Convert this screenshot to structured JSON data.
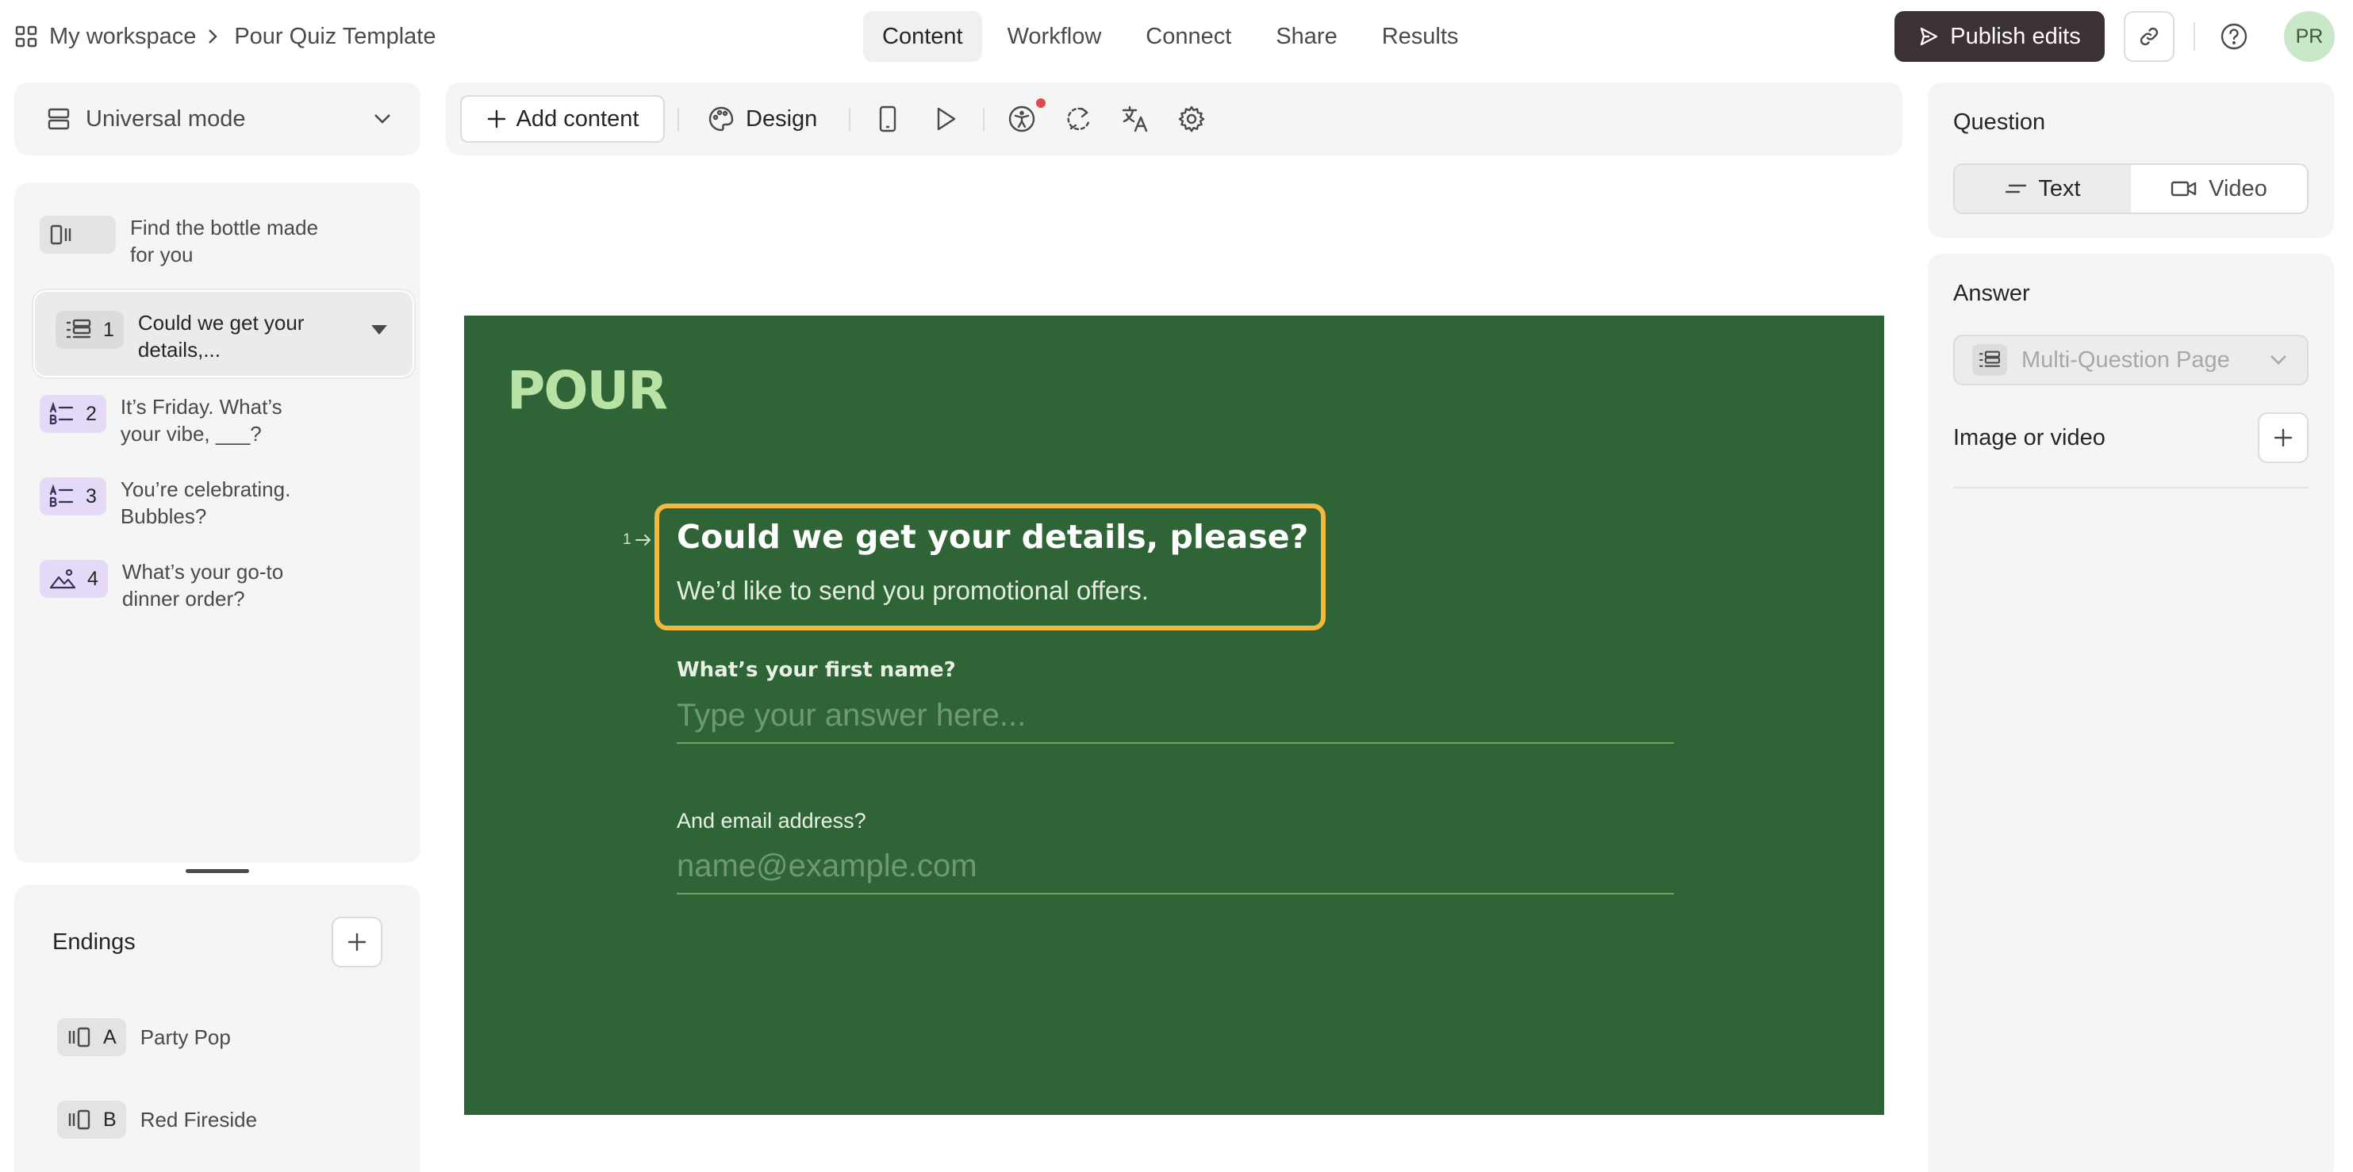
{
  "header": {
    "workspace": "My workspace",
    "separator": ">",
    "form_name": "Pour Quiz Template",
    "tabs": [
      {
        "label": "Content"
      },
      {
        "label": "Workflow"
      },
      {
        "label": "Connect"
      },
      {
        "label": "Share"
      },
      {
        "label": "Results"
      }
    ],
    "active_tab": "Content",
    "publish_label": "Publish edits",
    "avatar_initials": "PR"
  },
  "sidebar": {
    "mode_label": "Universal mode",
    "questions": [
      {
        "number": "",
        "text": "Find the bottle made for you",
        "type_icon": "welcome-screen-icon"
      },
      {
        "number": "1",
        "text": "Could we get your details,...",
        "type_icon": "multi-question-icon"
      },
      {
        "number": "2",
        "text": "It’s Friday. What’s your vibe, ___?",
        "type_icon": "multiple-choice-icon"
      },
      {
        "number": "3",
        "text": "You’re celebrating. Bubbles?",
        "type_icon": "multiple-choice-icon"
      },
      {
        "number": "4",
        "text": "What’s your go-to dinner order?",
        "type_icon": "picture-choice-icon"
      }
    ],
    "endings_title": "Endings",
    "endings": [
      {
        "letter": "A",
        "label": "Party Pop"
      },
      {
        "letter": "B",
        "label": "Red Fireside"
      }
    ]
  },
  "toolbar": {
    "add_content_label": "Add content",
    "design_label": "Design"
  },
  "canvas": {
    "logo": "POUR",
    "question_number": "1",
    "question_title": "Could we get your details, please?",
    "question_description": "We’d like to send you promotional offers.",
    "fields": [
      {
        "label": "What’s your first name?",
        "placeholder": "Type your answer here..."
      },
      {
        "label": "And email address?",
        "placeholder": "name@example.com"
      }
    ],
    "colors": {
      "background": "#2f6536",
      "highlight": "#f4b740",
      "logo": "#b9e3a5"
    }
  },
  "settings": {
    "question_label": "Question",
    "question_types": [
      {
        "label": "Text"
      },
      {
        "label": "Video"
      }
    ],
    "answer_label": "Answer",
    "answer_value": "Multi-Question Page",
    "image_or_video_label": "Image or video"
  }
}
